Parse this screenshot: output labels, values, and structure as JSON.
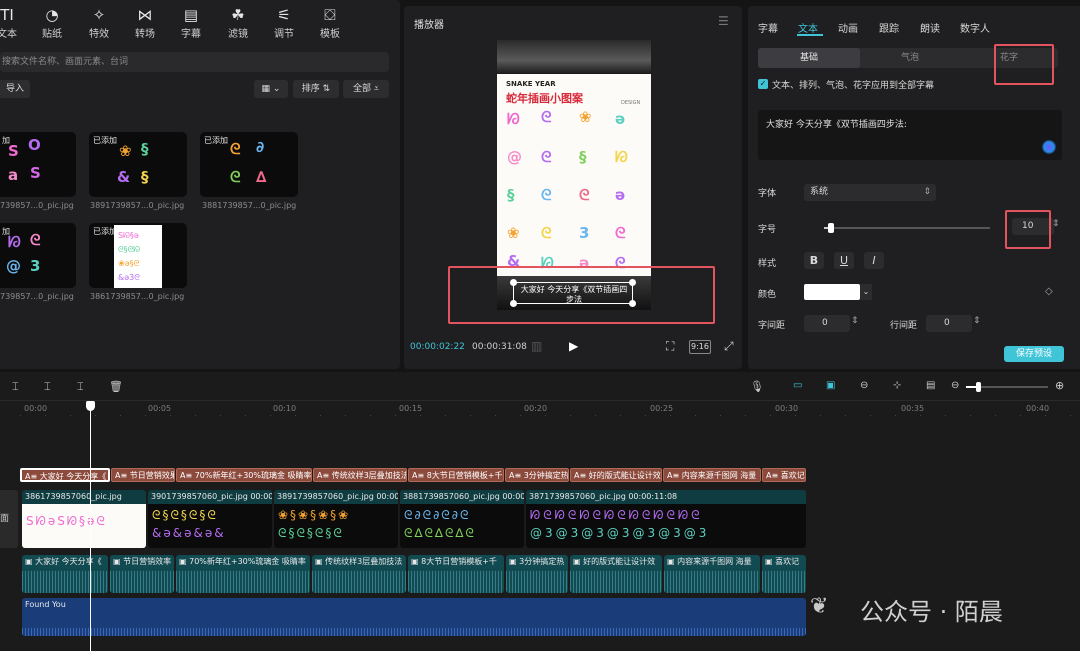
{
  "toolbar": {
    "items": [
      {
        "label": "文本",
        "icon": "text-icon"
      },
      {
        "label": "贴纸",
        "icon": "sticker-icon"
      },
      {
        "label": "特效",
        "icon": "effects-icon"
      },
      {
        "label": "转场",
        "icon": "transition-icon"
      },
      {
        "label": "字幕",
        "icon": "subtitle-icon"
      },
      {
        "label": "滤镜",
        "icon": "filter-icon"
      },
      {
        "label": "调节",
        "icon": "adjust-icon"
      },
      {
        "label": "模板",
        "icon": "template-icon"
      }
    ]
  },
  "media": {
    "search_placeholder": "搜索文件名称、画面元素、台词",
    "import_label": "导入",
    "sort_label": "排序",
    "all_label": "全部",
    "added_badge": "已添加",
    "added_badge_partial": "加",
    "thumbs": [
      {
        "caption": "739857...0_pic.jpg",
        "added": true
      },
      {
        "caption": "3891739857...0_pic.jpg",
        "added": true
      },
      {
        "caption": "3881739857...0_pic.jpg",
        "added": true
      },
      {
        "caption": "739857...0_pic.jpg",
        "added": true
      },
      {
        "caption": "3861739857...0_pic.jpg",
        "added": true
      }
    ]
  },
  "player": {
    "title": "播放器",
    "poster_header": "SNAKE YEAR",
    "poster_title": "蛇年插画小图案",
    "poster_tag": "DESIGN",
    "subtitle_line1": "大家好 今天分享《双节插画四",
    "subtitle_line2": "步法",
    "current_time": "00:00:02:22",
    "total_time": "00:00:31:08",
    "ratio": "9:16"
  },
  "inspector": {
    "tabs": [
      "字幕",
      "文本",
      "动画",
      "跟踪",
      "朗读",
      "数字人"
    ],
    "active_tab": "文本",
    "subtabs": [
      "基础",
      "气泡",
      "花字"
    ],
    "apply_all": "文本、排列、气泡、花字应用到全部字幕",
    "text_content": "大家好 今天分享《双节插画四步法:",
    "font_label": "字体",
    "font_value": "系统",
    "size_label": "字号",
    "size_value": "10",
    "size_slider_fraction": 0.04,
    "style_label": "样式",
    "bold": "B",
    "underline": "U",
    "italic": "I",
    "color_label": "颜色",
    "letter_spacing_label": "字间距",
    "letter_spacing_value": "0",
    "line_spacing_label": "行间距",
    "line_spacing_value": "0",
    "save_preset": "保存预设",
    "accent_color": "#3fc4d8"
  },
  "timeline": {
    "ticks": [
      "00:00",
      "00:05",
      "00:10",
      "00:15",
      "00:20",
      "00:25",
      "00:30",
      "00:35",
      "00:40"
    ],
    "track_label": "面",
    "text_clips": [
      "大家好 今天分享《",
      "节日营销效果",
      "70%新年红+30%琉璃金 吸睛率",
      "传统纹样3层叠加技法",
      "8大节日营销模板+千",
      "3分钟搞定热",
      "好的版式能让设计效",
      "内容来源千图网 海量",
      "喜欢记"
    ],
    "video_clips": [
      {
        "name": "3861739857060_pic.jpg"
      },
      {
        "name": "3901739857060_pic.jpg",
        "time": "00:00"
      },
      {
        "name": "3891739857060_pic.jpg",
        "time": "00:00"
      },
      {
        "name": "3881739857060_pic.jpg",
        "time": "00:00"
      },
      {
        "name": "3871739857060_pic.jpg",
        "time": "00:00:11:08"
      }
    ],
    "audio_clips": [
      "大家好 今天分享《",
      "节日营销效率",
      "70%新年红+30%琉璃金 吸睛率",
      "传统纹样3层叠加技法",
      "8大节日营销模板+千",
      "3分钟搞定热",
      "好的版式能让设计效",
      "内容来源千图网 海量",
      "喜欢记"
    ],
    "music_label": "Found You"
  },
  "watermark": {
    "text": "公众号 · 陌晨"
  }
}
